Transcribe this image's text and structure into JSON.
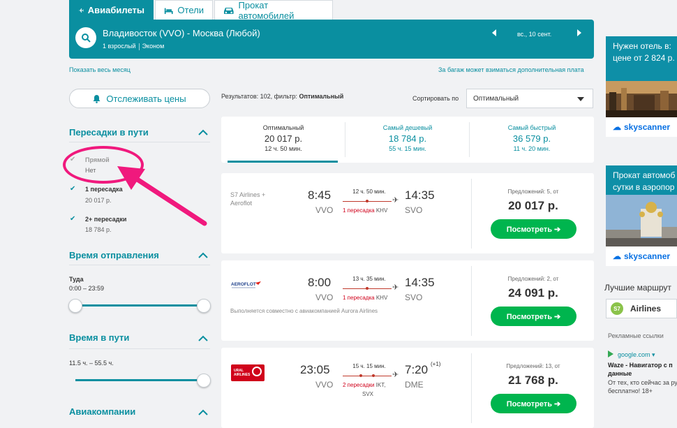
{
  "tabs": [
    {
      "label": "Авиабилеты",
      "icon": "plane-icon"
    },
    {
      "label": "Отели",
      "icon": "bed-icon"
    },
    {
      "label": "Прокат автомобилей",
      "icon": "car-icon"
    }
  ],
  "search": {
    "route": "Владивосток (VVO) - Москва (Любой)",
    "passengers": "1 взрослый",
    "cabin": "Эконом",
    "date": "вс., 10 сент.",
    "prev_icon": "triangle-left-icon",
    "next_icon": "triangle-right-icon"
  },
  "links": {
    "show_month": "Показать весь месяц",
    "baggage_note": "За багаж может взиматься дополнительная плата"
  },
  "sidebar": {
    "track_label": "Отслеживать цены",
    "stops": {
      "title": "Пересадки в пути",
      "options": [
        {
          "label": "Прямой",
          "sub": "Нет"
        },
        {
          "label": "1 пересадка",
          "sub": "20 017 р."
        },
        {
          "label": "2+ пересадки",
          "sub": "18 784 р."
        }
      ]
    },
    "departure": {
      "title": "Время отправления",
      "sub_label": "Туда",
      "range": "0:00 – 23:59"
    },
    "duration": {
      "title": "Время в пути",
      "range": "11.5 ч. – 55.5 ч."
    },
    "airlines": {
      "title": "Авиакомпании"
    }
  },
  "results": {
    "info_prefix": "Результатов: 102, фильтр: ",
    "info_filter": "Оптимальный",
    "sort_label": "Сортировать по",
    "sort_value": "Оптимальный"
  },
  "summary_tabs": [
    {
      "label": "Оптимальный",
      "price": "20 017 р.",
      "time": "12 ч. 50 мин."
    },
    {
      "label": "Самый дешевый",
      "price": "18 784 р.",
      "time": "55 ч. 15 мин."
    },
    {
      "label": "Самый быстрый",
      "price": "36 579 р.",
      "time": "11 ч. 20 мин."
    }
  ],
  "flights": [
    {
      "airline": "S7 Airlines +",
      "airline2": "Aeroflot",
      "dep": "8:45",
      "dep_code": "VVO",
      "duration": "12 ч. 50 мин.",
      "stops": "1 пересадка",
      "via": "KHV",
      "arr": "14:35",
      "arr_code": "SVO",
      "offers": "Предложений: 5, от",
      "price": "20 017 р.",
      "btn": "Посмотреть ➔"
    },
    {
      "airline_logo": "AEROFLOT",
      "dep": "8:00",
      "dep_code": "VVO",
      "duration": "13 ч. 35 мин.",
      "stops": "1 пересадка",
      "via": "KHV",
      "arr": "14:35",
      "arr_code": "SVO",
      "joint": "Выполняется совместно с авиакомпанией Aurora Airlines",
      "offers": "Предложений: 2, от",
      "price": "24 091 р.",
      "btn": "Посмотреть ➔"
    },
    {
      "airline_logo": "URAL AIRLINES",
      "dep": "23:05",
      "dep_code": "VVO",
      "duration": "15 ч. 15 мин.",
      "stops": "2 пересадки",
      "via": "IKT,",
      "via2": "SVX",
      "arr": "7:20",
      "arr_plus": "(+1)",
      "arr_code": "DME",
      "offers": "Предложений: 13, от",
      "price": "21 768 р.",
      "btn": "Посмотреть ➔"
    }
  ],
  "right": {
    "ad1": {
      "line1": "Нужен отель в:",
      "line2": "цене от 2 824 р.",
      "brand": "skyscanner"
    },
    "ad2": {
      "line1": "Прокат автомоб",
      "line2": "сутки в аэропор",
      "brand": "skyscanner"
    },
    "best_routes": "Лучшие маршрут",
    "s7": "Airlines",
    "s7_mark": "S7",
    "ads_title": "Рекламные ссылки",
    "google": "google.com ▾",
    "waze_title": "Waze - Навигатор с п",
    "waze_title2": "данные",
    "waze_desc": "От тех, кто сейчас за ру",
    "waze_desc2": "бесплатно! 18+"
  },
  "colors": {
    "brand": "#0a8fa0",
    "cta": "#00b54e",
    "annotation": "#f0197d",
    "stops_red": "#d0021b"
  }
}
